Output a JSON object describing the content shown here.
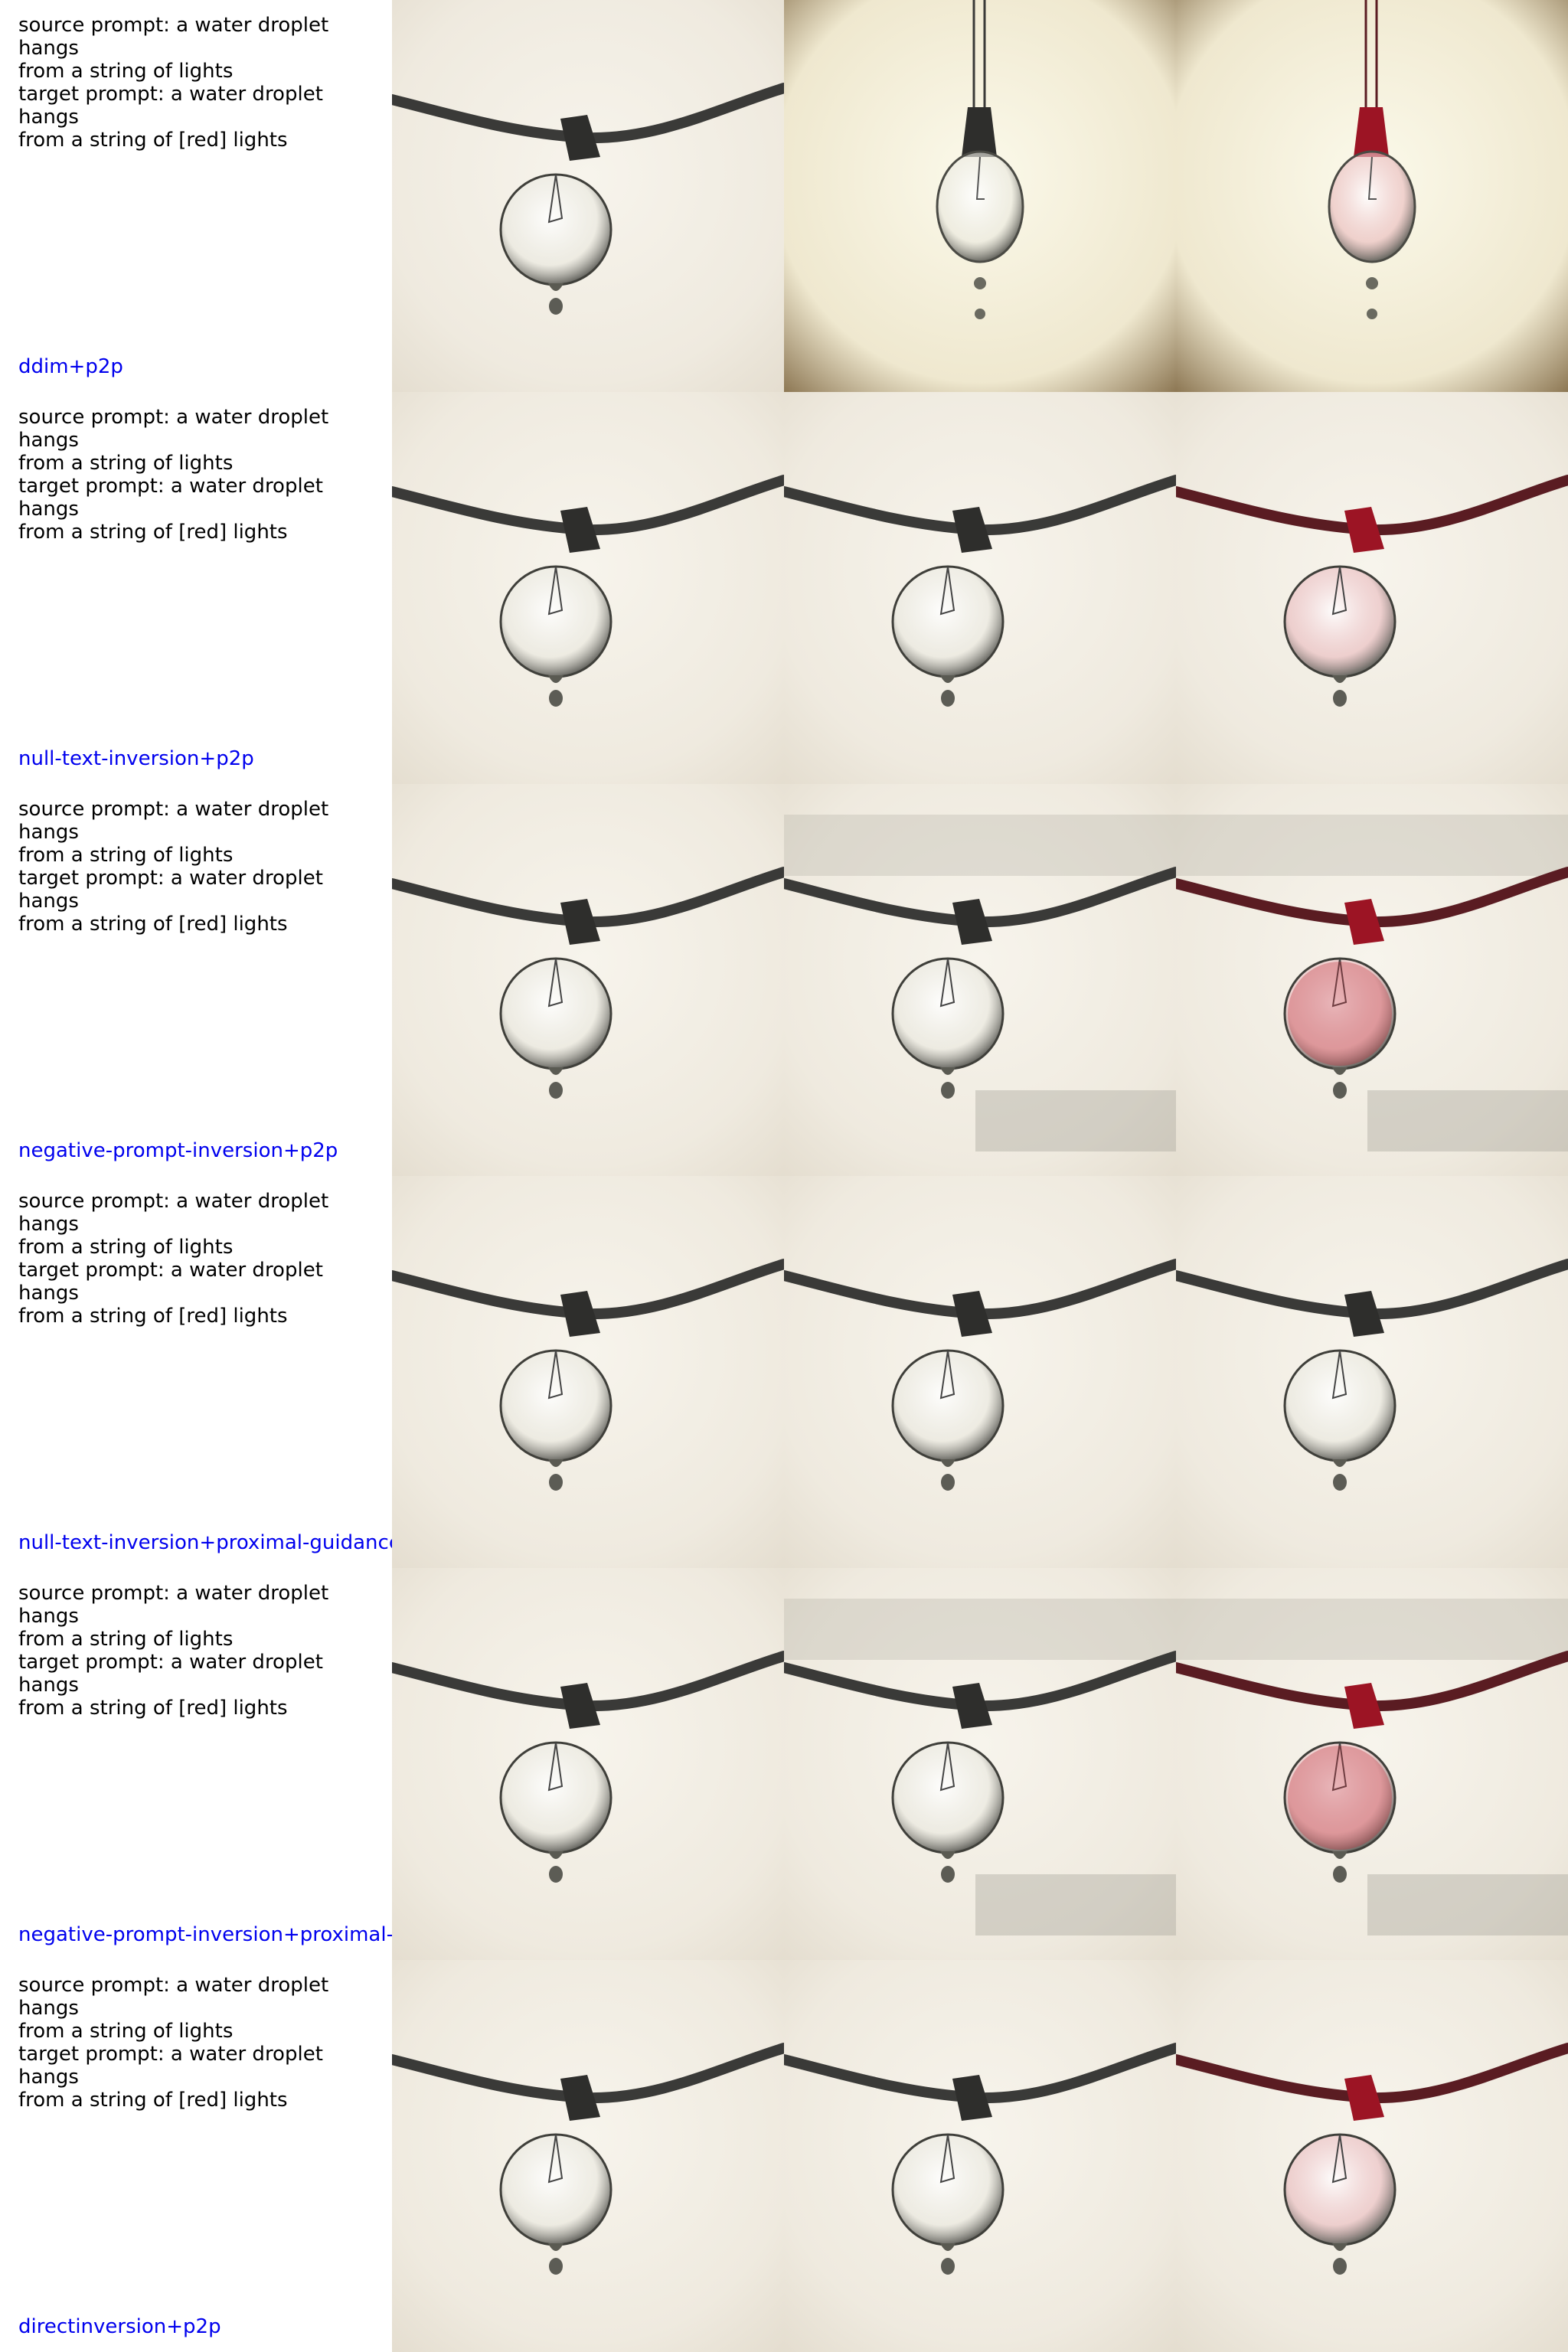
{
  "colors": {
    "method_label": "#0000ee",
    "background_light": "#f5f2ea",
    "background_warm": "#f3edd8",
    "cord": "#3a3a38",
    "red_tint": "#a01828"
  },
  "rows": [
    {
      "source_prompt_1": "source prompt: a water droplet hangs",
      "source_prompt_2": "from a string of lights",
      "target_prompt_1": "target prompt: a water droplet hangs",
      "target_prompt_2": "from a string of [red] lights",
      "method": "ddim+p2p",
      "panels": [
        {
          "variant": "source",
          "red": false
        },
        {
          "variant": "vignette",
          "red": false
        },
        {
          "variant": "vignette",
          "red": true
        }
      ]
    },
    {
      "source_prompt_1": "source prompt: a water droplet hangs",
      "source_prompt_2": "from a string of lights",
      "target_prompt_1": "target prompt: a water droplet hangs",
      "target_prompt_2": "from a string of [red] lights",
      "method": "null-text-inversion+p2p",
      "panels": [
        {
          "variant": "source",
          "red": false
        },
        {
          "variant": "source",
          "red": false
        },
        {
          "variant": "source",
          "red": true
        }
      ]
    },
    {
      "source_prompt_1": "source prompt: a water droplet hangs",
      "source_prompt_2": "from a string of lights",
      "target_prompt_1": "target prompt: a water droplet hangs",
      "target_prompt_2": "from a string of [red] lights",
      "method": "negative-prompt-inversion+p2p",
      "panels": [
        {
          "variant": "source",
          "red": false
        },
        {
          "variant": "shadowed",
          "red": false
        },
        {
          "variant": "shadowed",
          "red": true
        }
      ]
    },
    {
      "source_prompt_1": "source prompt: a water droplet hangs",
      "source_prompt_2": "from a string of lights",
      "target_prompt_1": "target prompt: a water droplet hangs",
      "target_prompt_2": "from a string of [red] lights",
      "method": "null-text-inversion+proximal-guidance",
      "panels": [
        {
          "variant": "source",
          "red": false
        },
        {
          "variant": "source",
          "red": false
        },
        {
          "variant": "source",
          "red": false
        }
      ]
    },
    {
      "source_prompt_1": "source prompt: a water droplet hangs",
      "source_prompt_2": "from a string of lights",
      "target_prompt_1": "target prompt: a water droplet hangs",
      "target_prompt_2": "from a string of [red] lights",
      "method": "negative-prompt-inversion+proximal-guidance",
      "panels": [
        {
          "variant": "source",
          "red": false
        },
        {
          "variant": "shadowed",
          "red": false
        },
        {
          "variant": "shadowed",
          "red": true
        }
      ]
    },
    {
      "source_prompt_1": "source prompt: a water droplet hangs",
      "source_prompt_2": "from a string of lights",
      "target_prompt_1": "target prompt: a water droplet hangs",
      "target_prompt_2": "from a string of [red] lights",
      "method": "directinversion+p2p",
      "panels": [
        {
          "variant": "source",
          "red": false
        },
        {
          "variant": "source",
          "red": false
        },
        {
          "variant": "source",
          "red": true
        }
      ]
    }
  ]
}
